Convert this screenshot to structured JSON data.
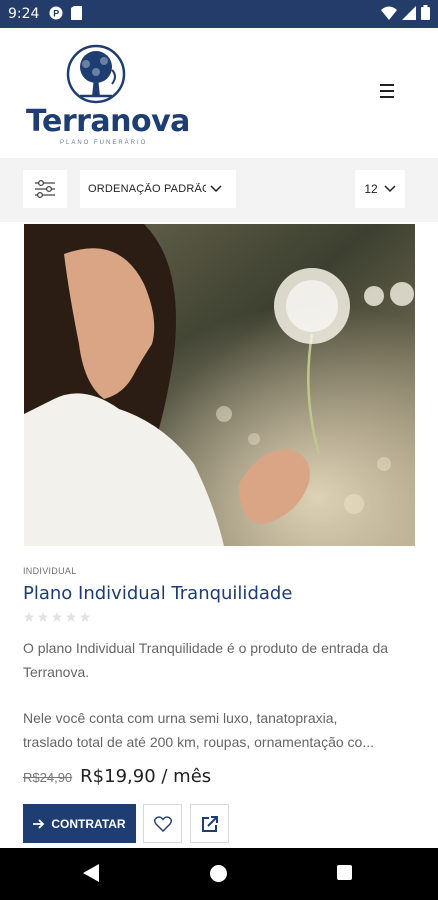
{
  "status_bar": {
    "time": "9:24",
    "icons": [
      "notification-p-icon",
      "sim-card-icon",
      "wifi-icon",
      "cell-signal-icon",
      "battery-icon"
    ]
  },
  "header": {
    "logo_text": "Terranova",
    "logo_subtitle": "PLANO FUNERÁRIO",
    "menu_icon": "hamburger-icon"
  },
  "toolbar": {
    "filter_icon": "sliders-icon",
    "sort_label": "ORDENAÇÃO PADRÃO",
    "per_page": "12"
  },
  "product": {
    "category": "INDIVIDUAL",
    "title": "Plano Individual Tranquilidade",
    "rating": 0,
    "rating_max": 5,
    "description_1": "O plano Individual Tranquilidade é o produto de entrada da Terranova.",
    "description_2_line1": "Nele você conta com urna semi luxo, tanatopraxia,",
    "description_2_line2": "traslado total de até 200 km, roupas, ornamentação co...",
    "old_price": "R$24,90",
    "price": "R$19,90 / mês",
    "button_label": "CONTRATAR"
  },
  "colors": {
    "brand": "#1e3d72",
    "status_bar": "#243c6a",
    "toolbar_bg": "#f3f3f3"
  }
}
